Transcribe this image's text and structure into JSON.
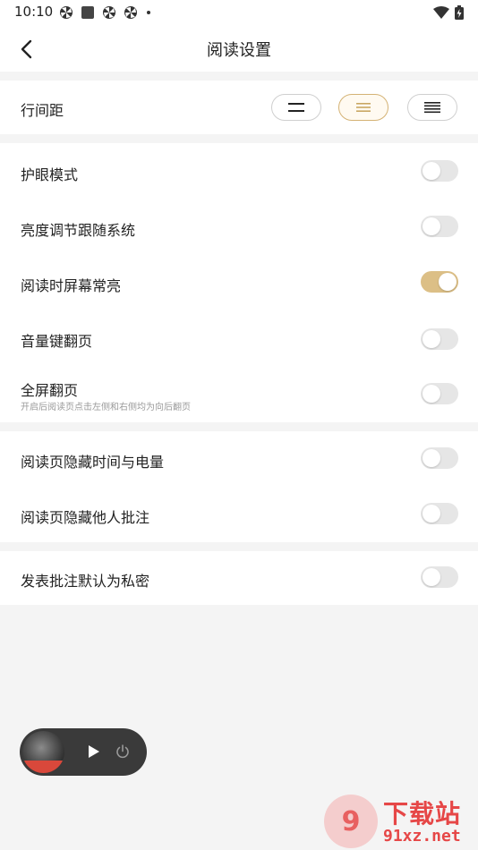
{
  "status_bar": {
    "time": "10:10",
    "icons": [
      "pinwheel-icon",
      "square-icon",
      "pinwheel-icon",
      "pinwheel-icon",
      "dot-icon"
    ],
    "right_icons": [
      "wifi-icon",
      "battery-charging-icon"
    ]
  },
  "header": {
    "title": "阅读设置",
    "back_icon": "chevron-left-icon"
  },
  "line_spacing": {
    "label": "行间距",
    "options": [
      "wide",
      "medium",
      "narrow"
    ],
    "selected_index": 1,
    "accent": "#d4b274"
  },
  "settings": {
    "eye_mode": {
      "label": "护眼模式",
      "on": false
    },
    "brightness_follow_system": {
      "label": "亮度调节跟随系统",
      "on": false
    },
    "screen_always_on": {
      "label": "阅读时屏幕常亮",
      "on": true
    },
    "volume_key_page": {
      "label": "音量键翻页",
      "on": false
    },
    "fullscreen_page": {
      "label": "全屏翻页",
      "sub": "开启后阅读页点击左侧和右侧均为向后翻页",
      "on": false
    },
    "hide_time_battery": {
      "label": "阅读页隐藏时间与电量",
      "on": false
    },
    "hide_others_notes": {
      "label": "阅读页隐藏他人批注",
      "on": false
    },
    "notes_private_default": {
      "label": "发表批注默认为私密",
      "on": false
    }
  },
  "toggle_on_color": "#dcbf86",
  "toggle_off_color": "#e6e6e6",
  "mini_player": {
    "play_icon": "play-icon",
    "power_icon": "power-icon"
  },
  "watermark": {
    "logo_text": "9",
    "title": "下载站",
    "url": "91xz.net",
    "color": "#e64747"
  }
}
